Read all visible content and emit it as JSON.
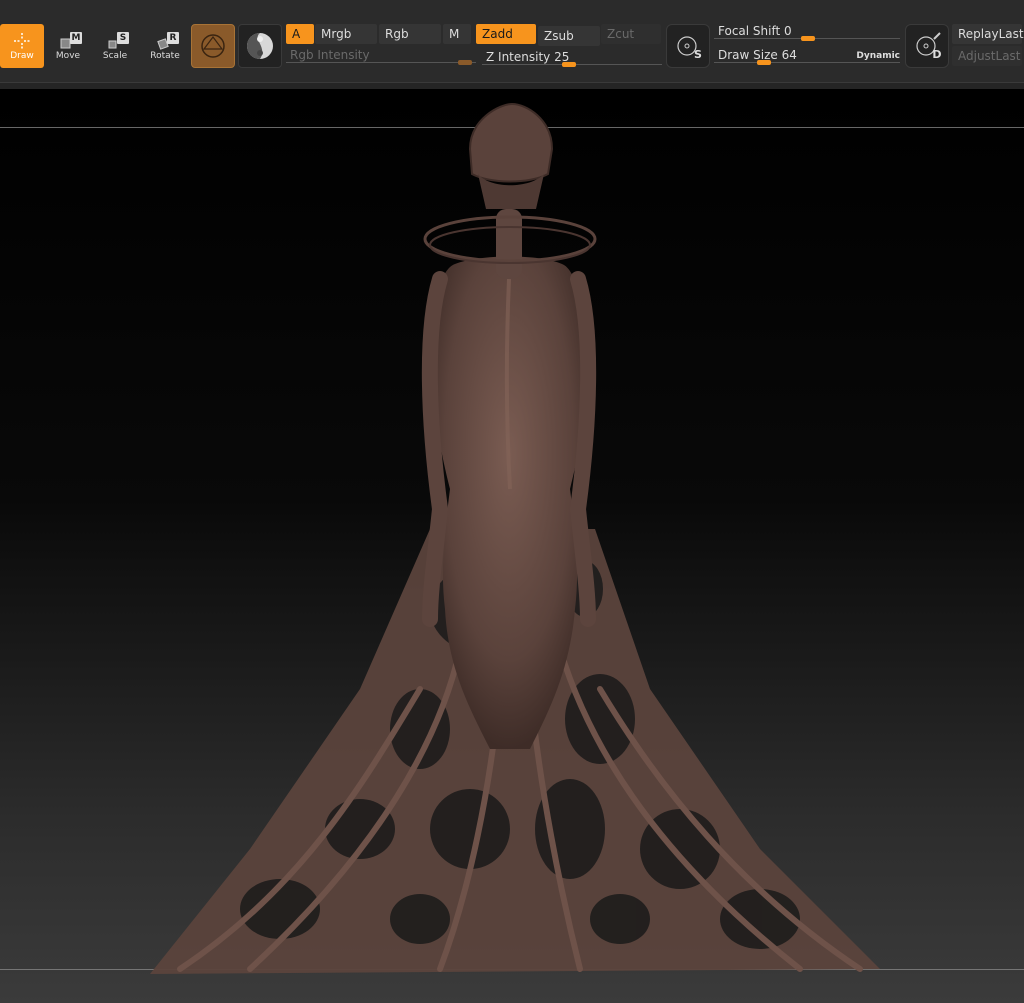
{
  "toolbar": {
    "tools": [
      {
        "label": "Draw",
        "badge": "",
        "active": true
      },
      {
        "label": "Move",
        "badge": "M",
        "active": false
      },
      {
        "label": "Scale",
        "badge": "S",
        "active": false
      },
      {
        "label": "Rotate",
        "badge": "R",
        "active": false
      }
    ],
    "brush_icon": "standard-brush-icon",
    "material_icon": "material-sphere-icon",
    "a_label": "A",
    "mrgb_label": "Mrgb",
    "rgb_label": "Rgb",
    "m_label": "M",
    "zadd_label": "Zadd",
    "zsub_label": "Zsub",
    "zcut_label": "Zcut",
    "rgb_intensity_label": "Rgb Intensity",
    "z_intensity_label": "Z Intensity",
    "z_intensity_value": "25",
    "focal_shift_label": "Focal Shift",
    "focal_shift_value": "0",
    "draw_size_label": "Draw Size",
    "draw_size_value": "64",
    "dynamic_label": "Dynamic",
    "s_badge": "S",
    "d_badge": "D",
    "replay_last_label": "ReplayLast",
    "adjust_last_label": "AdjustLast"
  },
  "colors": {
    "accent": "#f7941d",
    "toolbar_bg": "#2b2b2b",
    "model": "#6b5048"
  }
}
